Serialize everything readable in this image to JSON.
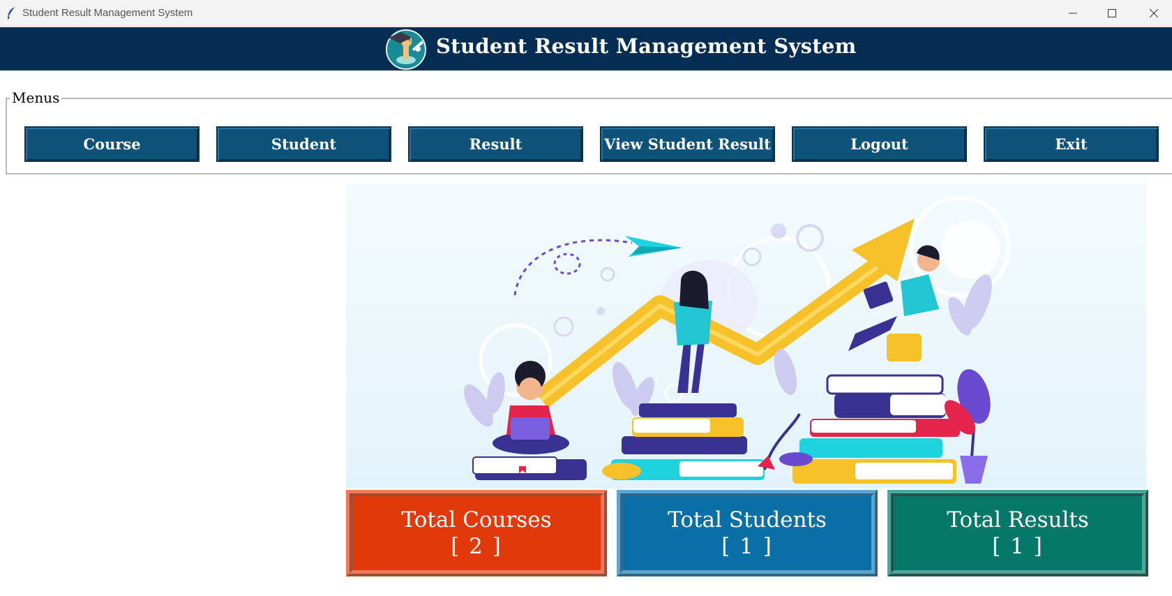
{
  "window": {
    "title": "Student Result Management System",
    "controls": [
      "minimize-icon",
      "maximize-icon",
      "close-icon"
    ]
  },
  "header": {
    "title": "Student Result Management System",
    "logo_icon": "graduation-cap-logo-icon",
    "background": "#062e55"
  },
  "menus": {
    "legend": "Menus",
    "buttons": [
      {
        "label": "Course"
      },
      {
        "label": "Student"
      },
      {
        "label": "Result"
      },
      {
        "label": "View Student Result"
      },
      {
        "label": "Logout"
      },
      {
        "label": "Exit"
      }
    ],
    "button_color": "#0e527a"
  },
  "stats": {
    "courses": {
      "label": "Total Courses",
      "value": "[ 2 ]",
      "color": "#e2390a"
    },
    "students": {
      "label": "Total Students",
      "value": "[ 1 ]",
      "color": "#0b6fa7"
    },
    "results": {
      "label": "Total Results",
      "value": "[ 1 ]",
      "color": "#05786a"
    }
  }
}
